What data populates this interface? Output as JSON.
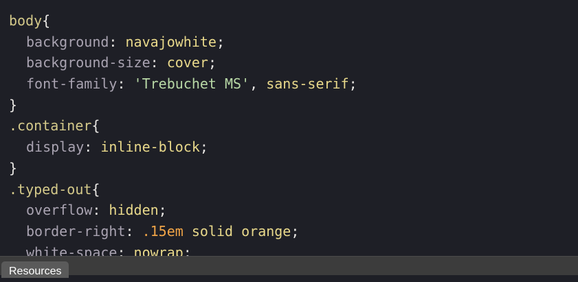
{
  "editor": {
    "lines": [
      {
        "selector": "body",
        "open": "{"
      },
      {
        "prop": "background",
        "parts": [
          {
            "t": "val",
            "v": "navajowhite"
          }
        ]
      },
      {
        "prop": "background-size",
        "parts": [
          {
            "t": "val",
            "v": "cover"
          }
        ]
      },
      {
        "prop": "font-family",
        "parts": [
          {
            "t": "str",
            "v": "'Trebuchet MS'"
          },
          {
            "t": "punc",
            "v": ", "
          },
          {
            "t": "val",
            "v": "sans-serif"
          }
        ]
      },
      {
        "close": "}"
      },
      {
        "selector": ".container",
        "open": "{"
      },
      {
        "prop": "display",
        "parts": [
          {
            "t": "val",
            "v": "inline-block"
          }
        ]
      },
      {
        "close": "}"
      },
      {
        "selector": ".typed-out",
        "open": "{"
      },
      {
        "prop": "overflow",
        "parts": [
          {
            "t": "val",
            "v": "hidden"
          }
        ]
      },
      {
        "prop": "border-right",
        "parts": [
          {
            "t": "num",
            "v": ".15em"
          },
          {
            "t": "punc",
            "v": " "
          },
          {
            "t": "val",
            "v": "solid orange"
          }
        ]
      },
      {
        "prop": "white-space",
        "parts": [
          {
            "t": "val",
            "v": "nowrap"
          }
        ]
      }
    ]
  },
  "bottom_panel": {
    "tab_label": "Resources"
  },
  "colors": {
    "background": "#1e1f26",
    "selector": "#d4c98a",
    "property": "#a9a3b1",
    "value": "#e9d98b",
    "string": "#b8d8a6",
    "number": "#f0a447"
  }
}
